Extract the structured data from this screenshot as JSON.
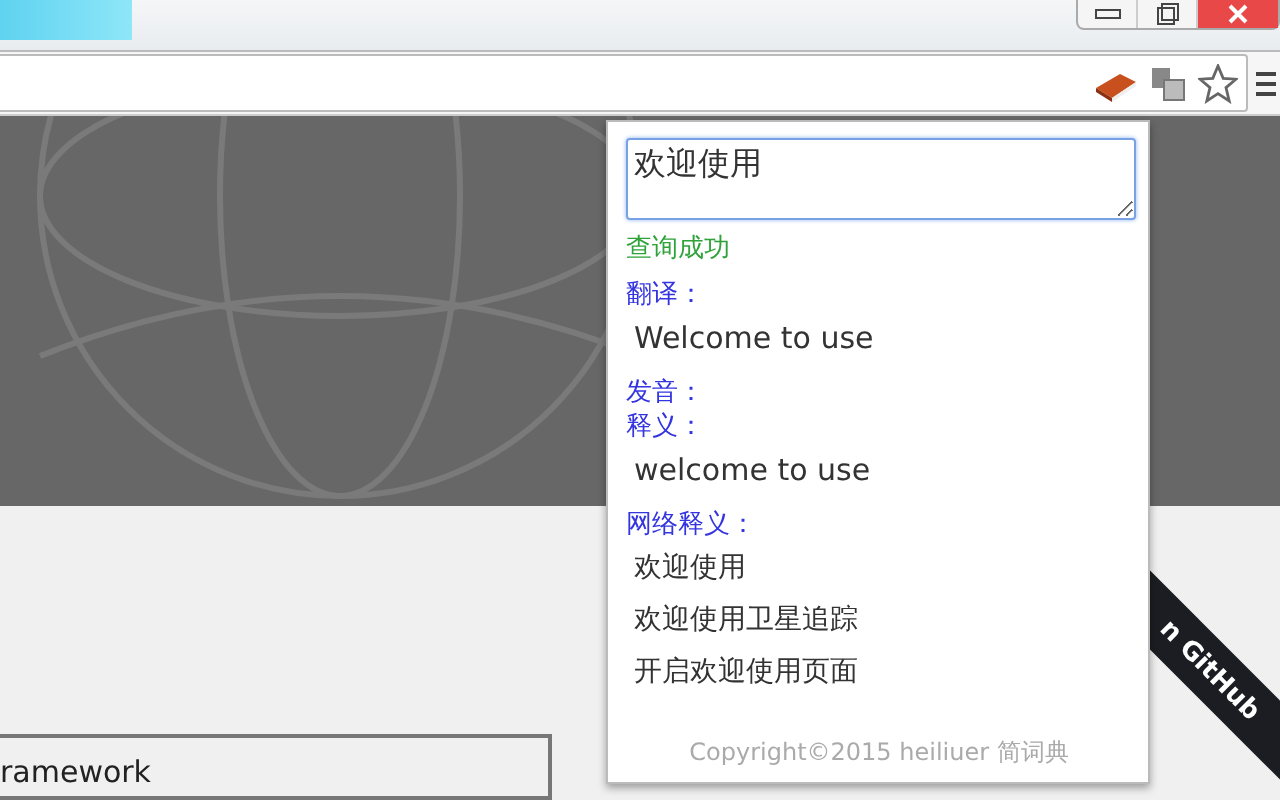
{
  "popup": {
    "query": "欢迎使用",
    "status": "查询成功",
    "sections": [
      {
        "label": "翻译：",
        "items": [
          "Welcome to use"
        ]
      },
      {
        "label": "发音："
      },
      {
        "label": "释义：",
        "items": [
          "welcome to use"
        ]
      },
      {
        "label": "网络释义：",
        "items": [
          "欢迎使用",
          "欢迎使用卫星追踪",
          "开启欢迎使用页面"
        ]
      }
    ],
    "footer": "Copyright©2015 heiliuer 简词典"
  },
  "page": {
    "ribbon": "n GitHub",
    "box_text": "ramework"
  }
}
